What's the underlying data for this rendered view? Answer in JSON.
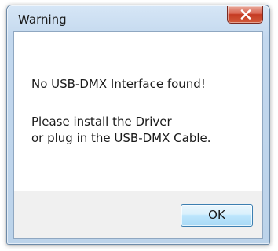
{
  "window": {
    "title": "Warning"
  },
  "dialog": {
    "message": "No USB-DMX Interface found!",
    "instruction_line1": "Please install the Driver",
    "instruction_line2": "or plug in the USB-DMX Cable."
  },
  "buttons": {
    "ok_label": "OK"
  },
  "icons": {
    "close": "close-icon"
  },
  "colors": {
    "close_button": "#c9452e",
    "footer": "#f0f0f0",
    "ok_border": "#3c7fb1"
  }
}
